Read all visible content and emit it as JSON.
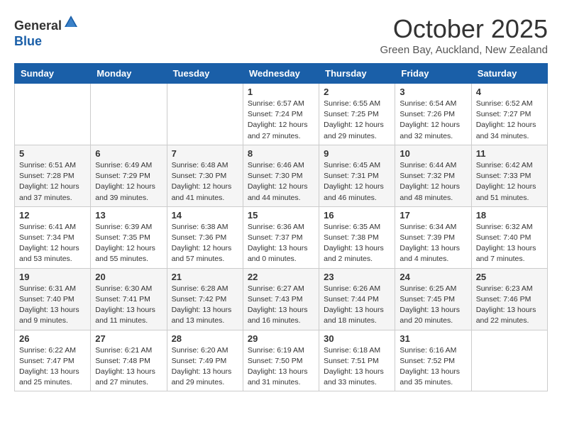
{
  "header": {
    "logo_line1": "General",
    "logo_line2": "Blue",
    "month_title": "October 2025",
    "subtitle": "Green Bay, Auckland, New Zealand"
  },
  "weekdays": [
    "Sunday",
    "Monday",
    "Tuesday",
    "Wednesday",
    "Thursday",
    "Friday",
    "Saturday"
  ],
  "weeks": [
    [
      {
        "day": "",
        "info": ""
      },
      {
        "day": "",
        "info": ""
      },
      {
        "day": "",
        "info": ""
      },
      {
        "day": "1",
        "info": "Sunrise: 6:57 AM\nSunset: 7:24 PM\nDaylight: 12 hours\nand 27 minutes."
      },
      {
        "day": "2",
        "info": "Sunrise: 6:55 AM\nSunset: 7:25 PM\nDaylight: 12 hours\nand 29 minutes."
      },
      {
        "day": "3",
        "info": "Sunrise: 6:54 AM\nSunset: 7:26 PM\nDaylight: 12 hours\nand 32 minutes."
      },
      {
        "day": "4",
        "info": "Sunrise: 6:52 AM\nSunset: 7:27 PM\nDaylight: 12 hours\nand 34 minutes."
      }
    ],
    [
      {
        "day": "5",
        "info": "Sunrise: 6:51 AM\nSunset: 7:28 PM\nDaylight: 12 hours\nand 37 minutes."
      },
      {
        "day": "6",
        "info": "Sunrise: 6:49 AM\nSunset: 7:29 PM\nDaylight: 12 hours\nand 39 minutes."
      },
      {
        "day": "7",
        "info": "Sunrise: 6:48 AM\nSunset: 7:30 PM\nDaylight: 12 hours\nand 41 minutes."
      },
      {
        "day": "8",
        "info": "Sunrise: 6:46 AM\nSunset: 7:30 PM\nDaylight: 12 hours\nand 44 minutes."
      },
      {
        "day": "9",
        "info": "Sunrise: 6:45 AM\nSunset: 7:31 PM\nDaylight: 12 hours\nand 46 minutes."
      },
      {
        "day": "10",
        "info": "Sunrise: 6:44 AM\nSunset: 7:32 PM\nDaylight: 12 hours\nand 48 minutes."
      },
      {
        "day": "11",
        "info": "Sunrise: 6:42 AM\nSunset: 7:33 PM\nDaylight: 12 hours\nand 51 minutes."
      }
    ],
    [
      {
        "day": "12",
        "info": "Sunrise: 6:41 AM\nSunset: 7:34 PM\nDaylight: 12 hours\nand 53 minutes."
      },
      {
        "day": "13",
        "info": "Sunrise: 6:39 AM\nSunset: 7:35 PM\nDaylight: 12 hours\nand 55 minutes."
      },
      {
        "day": "14",
        "info": "Sunrise: 6:38 AM\nSunset: 7:36 PM\nDaylight: 12 hours\nand 57 minutes."
      },
      {
        "day": "15",
        "info": "Sunrise: 6:36 AM\nSunset: 7:37 PM\nDaylight: 13 hours\nand 0 minutes."
      },
      {
        "day": "16",
        "info": "Sunrise: 6:35 AM\nSunset: 7:38 PM\nDaylight: 13 hours\nand 2 minutes."
      },
      {
        "day": "17",
        "info": "Sunrise: 6:34 AM\nSunset: 7:39 PM\nDaylight: 13 hours\nand 4 minutes."
      },
      {
        "day": "18",
        "info": "Sunrise: 6:32 AM\nSunset: 7:40 PM\nDaylight: 13 hours\nand 7 minutes."
      }
    ],
    [
      {
        "day": "19",
        "info": "Sunrise: 6:31 AM\nSunset: 7:40 PM\nDaylight: 13 hours\nand 9 minutes."
      },
      {
        "day": "20",
        "info": "Sunrise: 6:30 AM\nSunset: 7:41 PM\nDaylight: 13 hours\nand 11 minutes."
      },
      {
        "day": "21",
        "info": "Sunrise: 6:28 AM\nSunset: 7:42 PM\nDaylight: 13 hours\nand 13 minutes."
      },
      {
        "day": "22",
        "info": "Sunrise: 6:27 AM\nSunset: 7:43 PM\nDaylight: 13 hours\nand 16 minutes."
      },
      {
        "day": "23",
        "info": "Sunrise: 6:26 AM\nSunset: 7:44 PM\nDaylight: 13 hours\nand 18 minutes."
      },
      {
        "day": "24",
        "info": "Sunrise: 6:25 AM\nSunset: 7:45 PM\nDaylight: 13 hours\nand 20 minutes."
      },
      {
        "day": "25",
        "info": "Sunrise: 6:23 AM\nSunset: 7:46 PM\nDaylight: 13 hours\nand 22 minutes."
      }
    ],
    [
      {
        "day": "26",
        "info": "Sunrise: 6:22 AM\nSunset: 7:47 PM\nDaylight: 13 hours\nand 25 minutes."
      },
      {
        "day": "27",
        "info": "Sunrise: 6:21 AM\nSunset: 7:48 PM\nDaylight: 13 hours\nand 27 minutes."
      },
      {
        "day": "28",
        "info": "Sunrise: 6:20 AM\nSunset: 7:49 PM\nDaylight: 13 hours\nand 29 minutes."
      },
      {
        "day": "29",
        "info": "Sunrise: 6:19 AM\nSunset: 7:50 PM\nDaylight: 13 hours\nand 31 minutes."
      },
      {
        "day": "30",
        "info": "Sunrise: 6:18 AM\nSunset: 7:51 PM\nDaylight: 13 hours\nand 33 minutes."
      },
      {
        "day": "31",
        "info": "Sunrise: 6:16 AM\nSunset: 7:52 PM\nDaylight: 13 hours\nand 35 minutes."
      },
      {
        "day": "",
        "info": ""
      }
    ]
  ]
}
